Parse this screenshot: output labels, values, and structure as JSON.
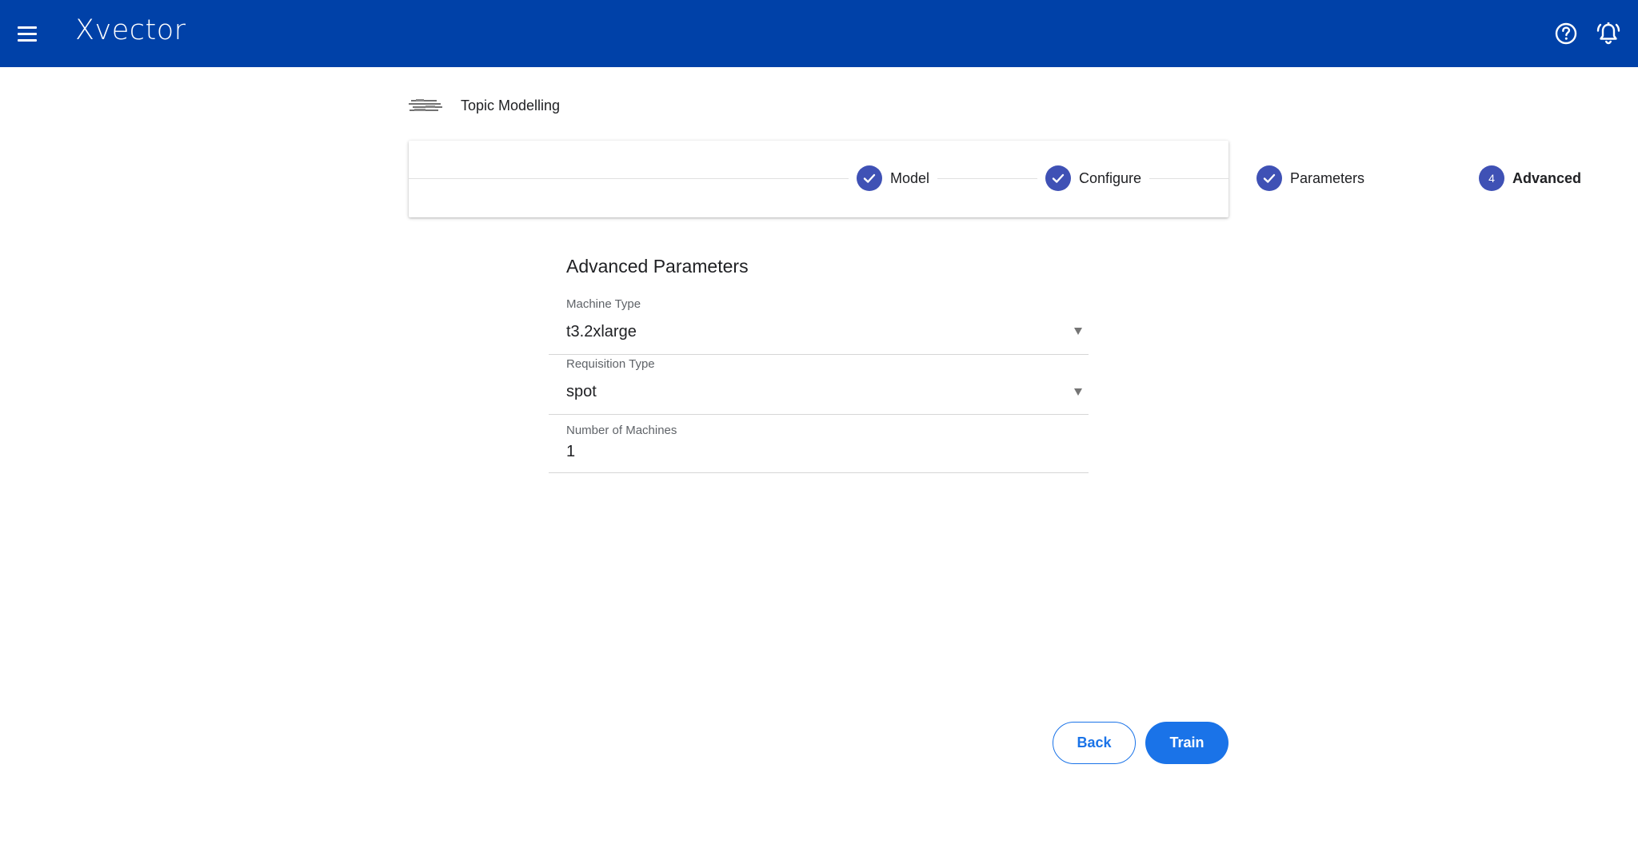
{
  "header": {
    "brand": "Xvector",
    "color": "#0041a8"
  },
  "page": {
    "title": "Topic Modelling"
  },
  "stepper": {
    "steps": [
      {
        "label": "Model",
        "state": "done"
      },
      {
        "label": "Configure",
        "state": "done"
      },
      {
        "label": "Parameters",
        "state": "done"
      },
      {
        "label": "Advanced",
        "state": "active",
        "number": "4"
      }
    ],
    "accent": "#3f51b5"
  },
  "form": {
    "title": "Advanced Parameters",
    "machine_type": {
      "label": "Machine Type",
      "value": "t3.2xlarge"
    },
    "requisition_type": {
      "label": "Requisition Type",
      "value": "spot"
    },
    "number_of_machines": {
      "label": "Number of Machines",
      "value": "1"
    }
  },
  "actions": {
    "back_label": "Back",
    "train_label": "Train",
    "primary_color": "#1a73e8"
  }
}
